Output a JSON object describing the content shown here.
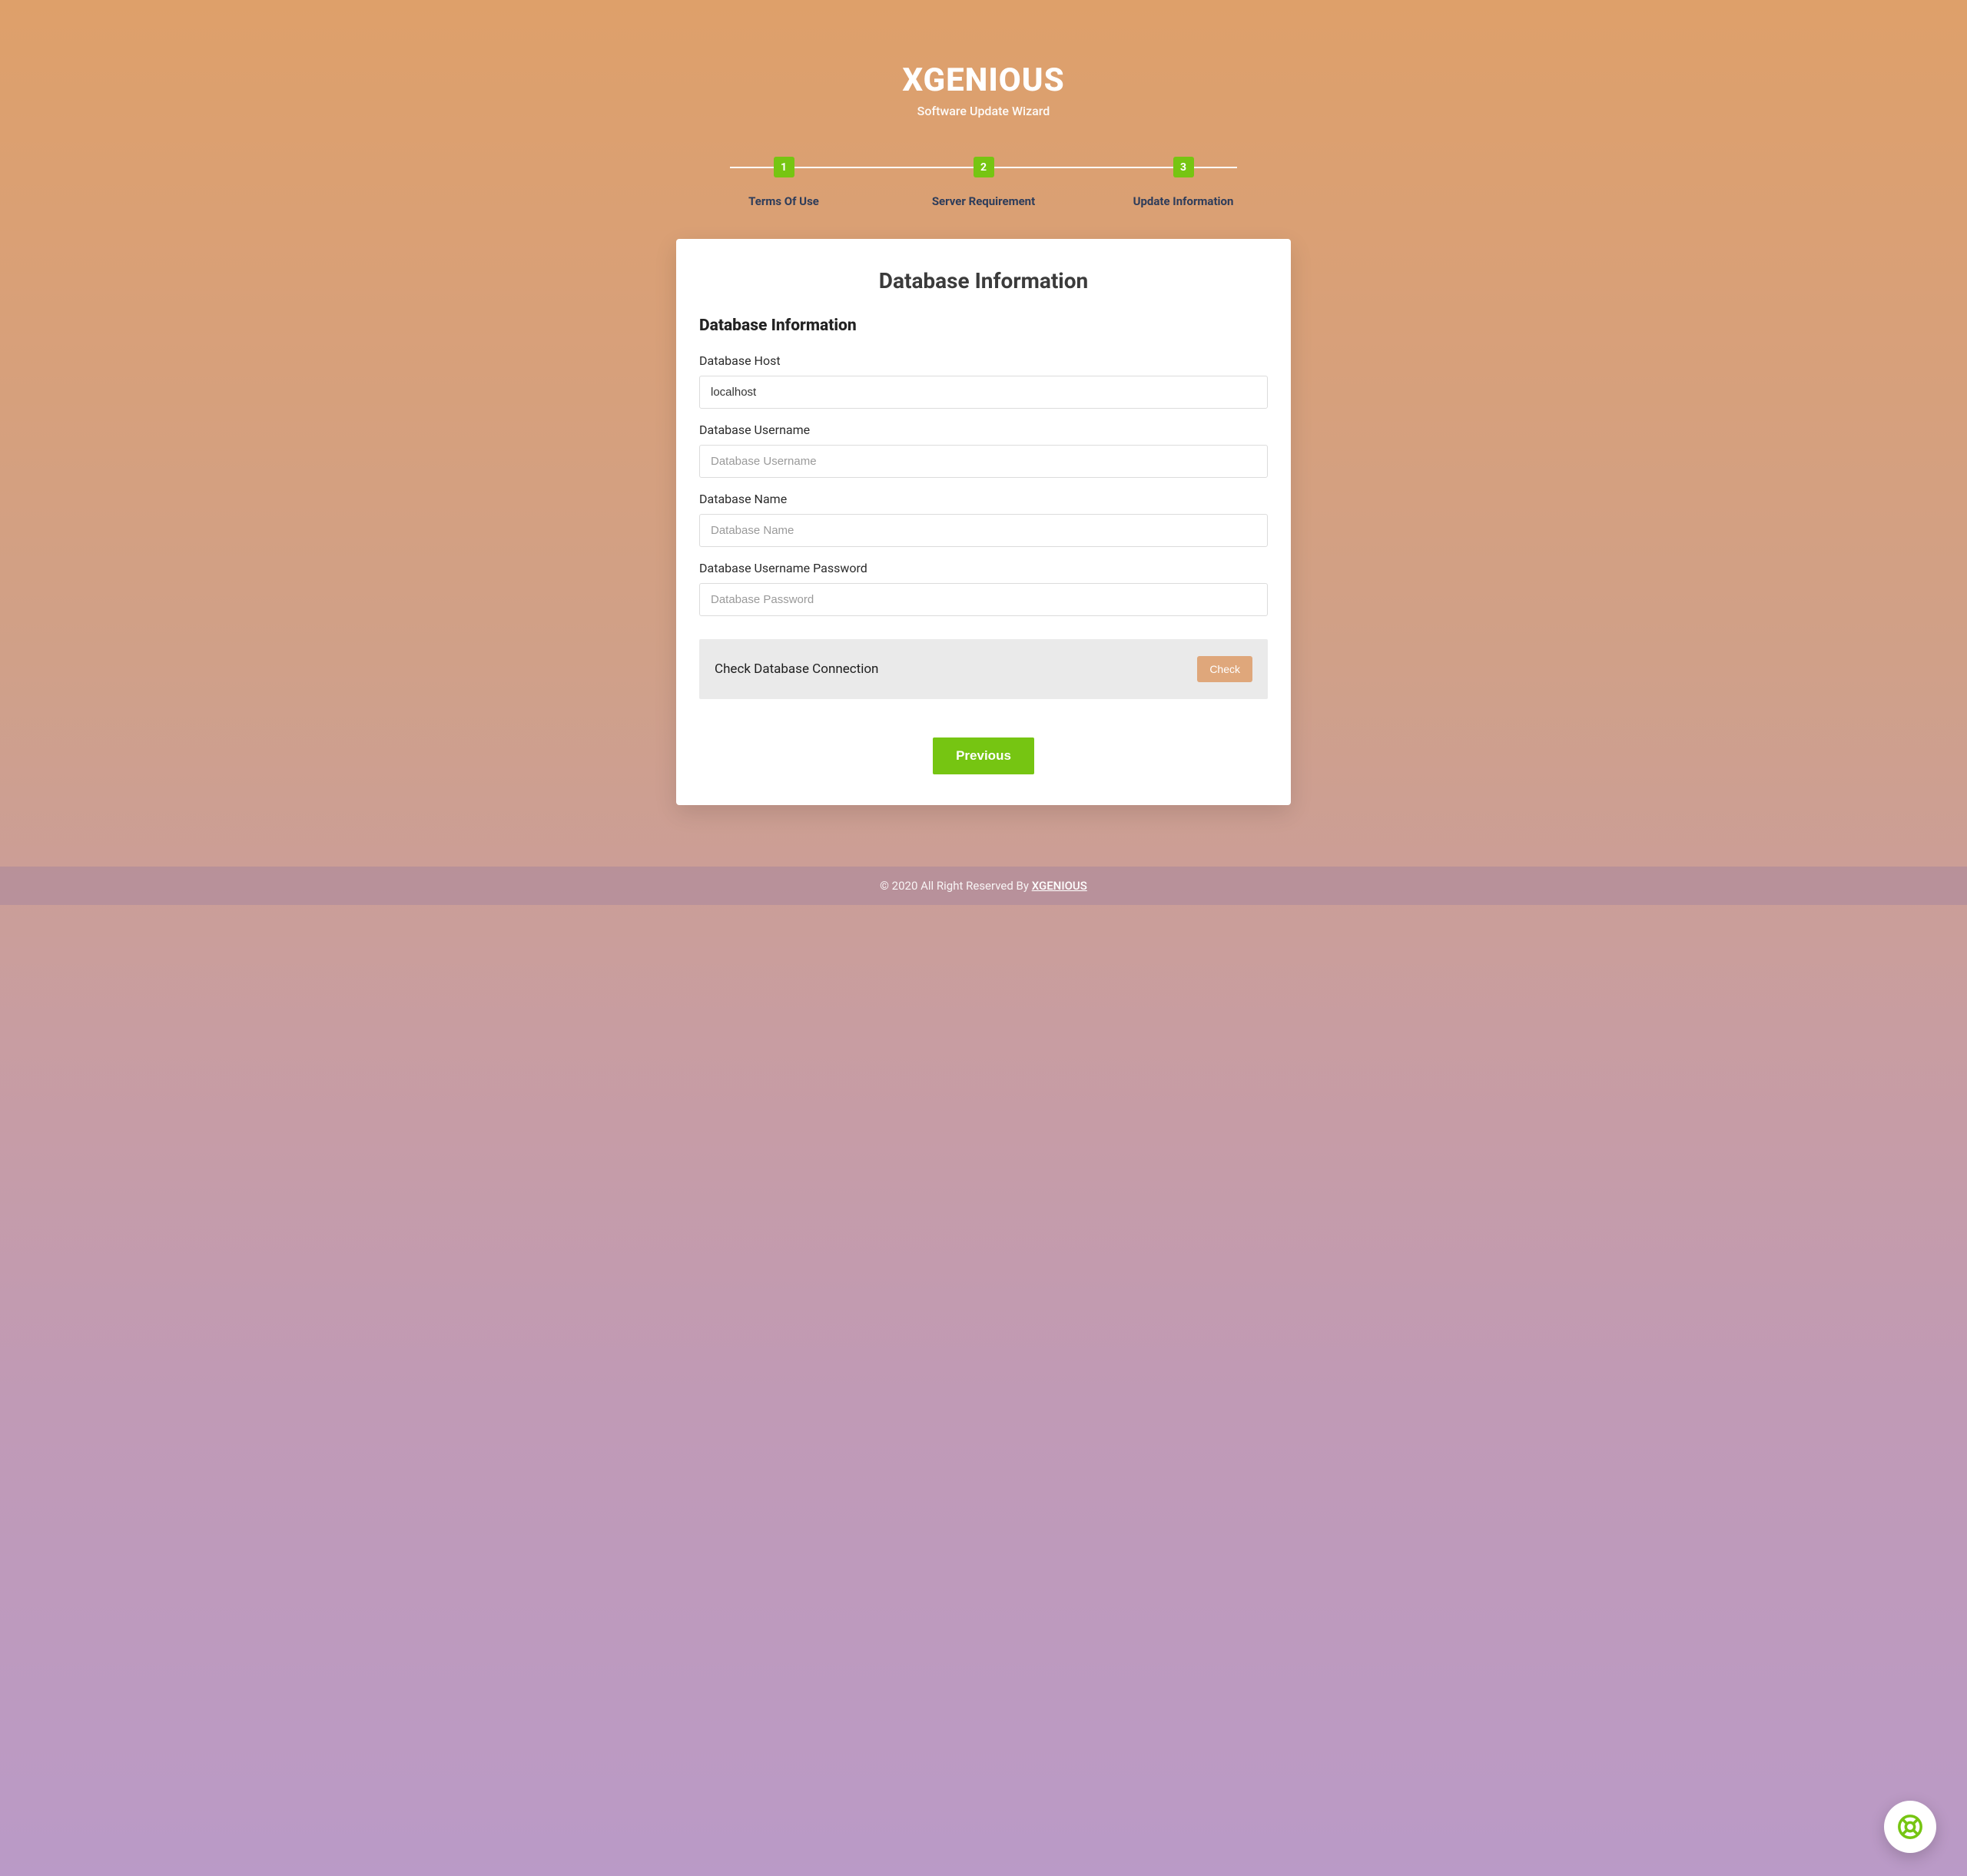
{
  "header": {
    "title": "XGENIOUS",
    "subtitle": "Software Update Wizard"
  },
  "steps": [
    {
      "num": "1",
      "label": "Terms Of Use"
    },
    {
      "num": "2",
      "label": "Server Requirement"
    },
    {
      "num": "3",
      "label": "Update Information"
    }
  ],
  "card": {
    "title": "Database Information",
    "section_title": "Database Information"
  },
  "fields": {
    "host": {
      "label": "Database Host",
      "value": "localhost",
      "placeholder": ""
    },
    "user": {
      "label": "Database Username",
      "value": "",
      "placeholder": "Database Username"
    },
    "name": {
      "label": "Database Name",
      "value": "",
      "placeholder": "Database Name"
    },
    "password": {
      "label": "Database Username Password",
      "value": "",
      "placeholder": "Database Password"
    }
  },
  "check": {
    "label": "Check Database Connection",
    "button": "Check"
  },
  "nav": {
    "previous": "Previous"
  },
  "footer": {
    "text": "© 2020 All Right Reserved By ",
    "link": "XGENIOUS"
  }
}
